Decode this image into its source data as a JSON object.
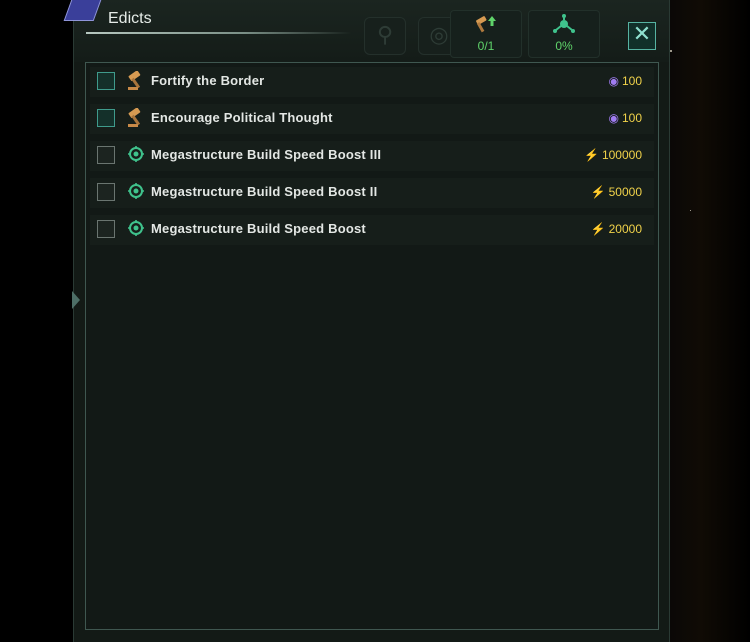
{
  "window": {
    "title": "Edicts"
  },
  "stats": [
    {
      "icon": "edict-cap-icon",
      "value": "0/1"
    },
    {
      "icon": "hub-icon",
      "value": "0%"
    }
  ],
  "edicts": [
    {
      "name": "Fortify the Border",
      "icon": "gavel-icon",
      "cost_type": "influence",
      "cost": "100",
      "checkbox_style": "teal"
    },
    {
      "name": "Encourage Political Thought",
      "icon": "gavel-icon",
      "cost_type": "influence",
      "cost": "100",
      "checkbox_style": "teal"
    },
    {
      "name": "Megastructure Build Speed Boost III",
      "icon": "megastructure-icon",
      "cost_type": "energy",
      "cost": "100000",
      "checkbox_style": "gray"
    },
    {
      "name": "Megastructure Build Speed Boost II",
      "icon": "megastructure-icon",
      "cost_type": "energy",
      "cost": "50000",
      "checkbox_style": "gray"
    },
    {
      "name": "Megastructure Build Speed Boost",
      "icon": "megastructure-icon",
      "cost_type": "energy",
      "cost": "20000",
      "checkbox_style": "gray"
    }
  ],
  "colors": {
    "influence": "#a07cf2",
    "energy": "#f0c230",
    "accent": "#56b3a2",
    "stat_text": "#5fd36a"
  }
}
